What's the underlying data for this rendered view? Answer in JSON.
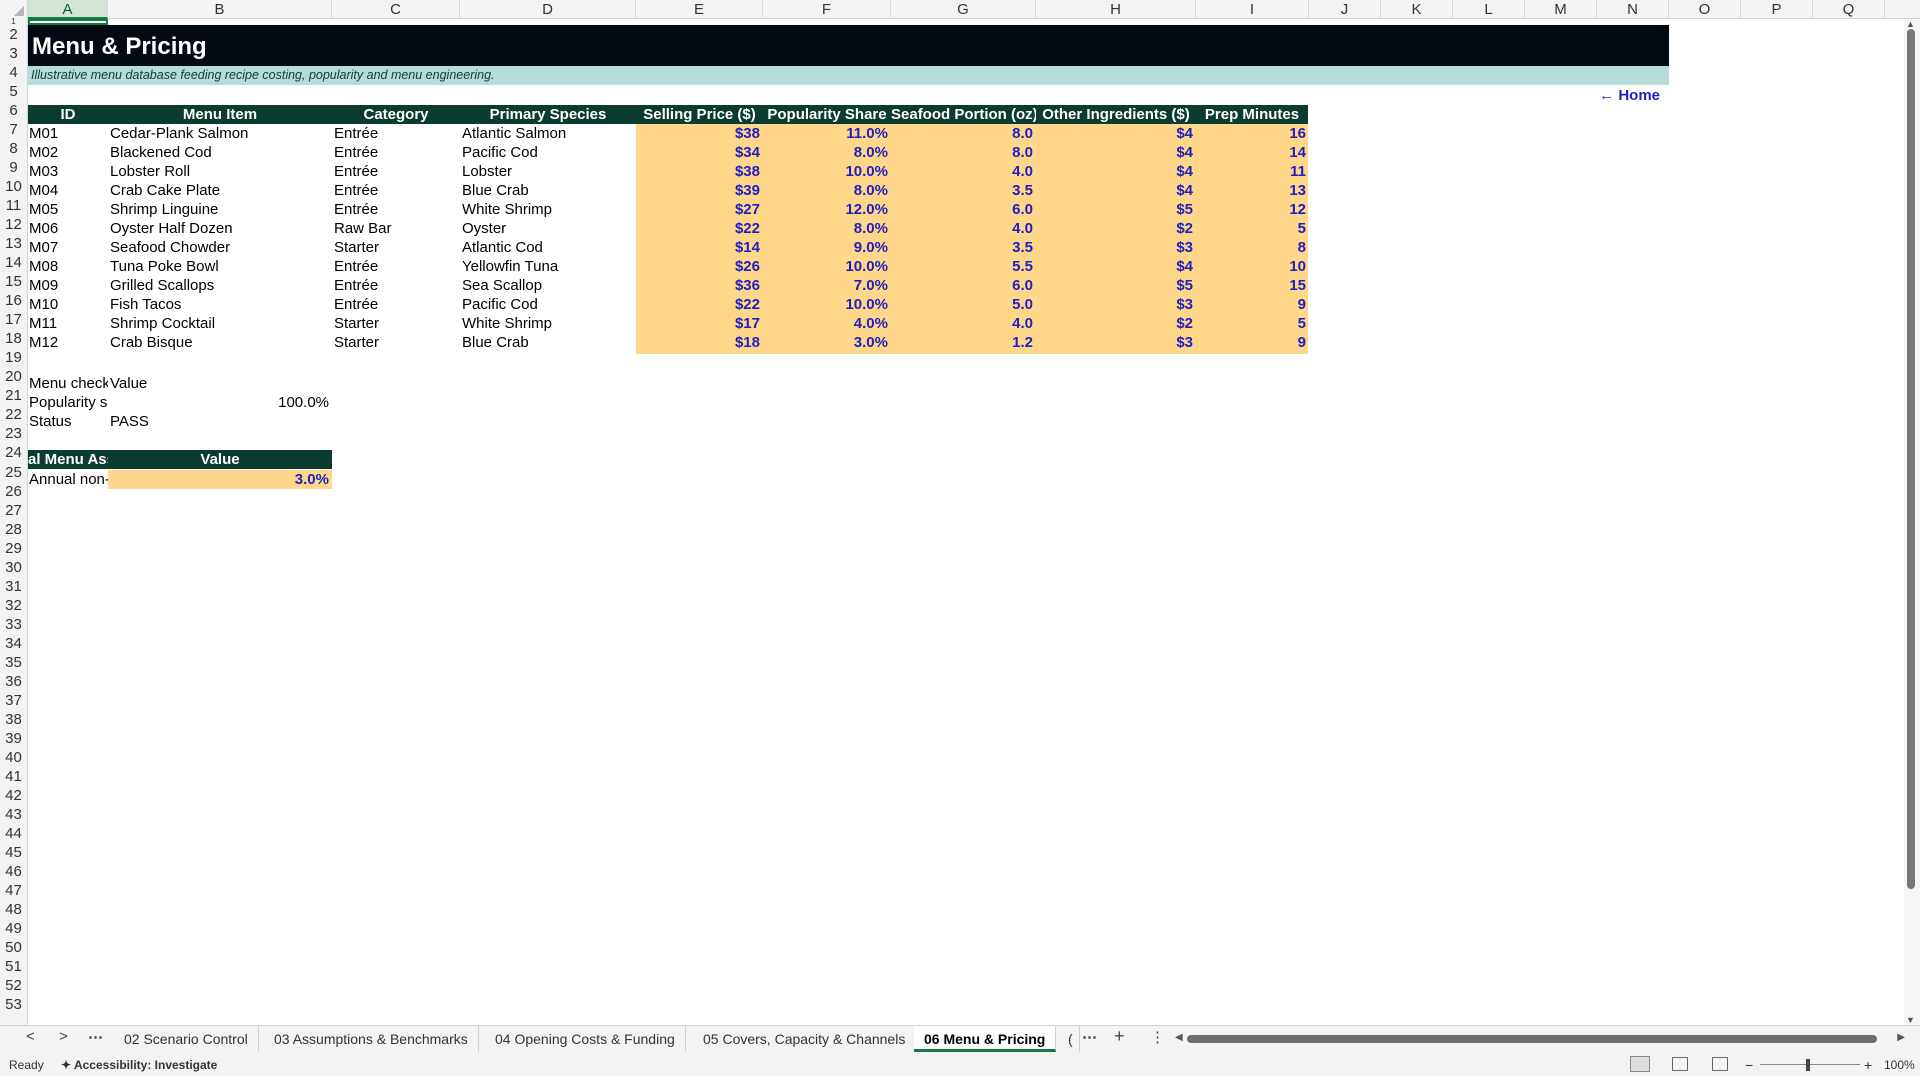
{
  "columns": [
    "A",
    "B",
    "C",
    "D",
    "E",
    "F",
    "G",
    "H",
    "I",
    "J",
    "K",
    "L",
    "M",
    "N",
    "O",
    "P",
    "Q"
  ],
  "row_numbers": [
    "1",
    "2",
    "3",
    "4",
    "5",
    "6",
    "7",
    "8",
    "9",
    "10",
    "11",
    "12",
    "13",
    "14",
    "15",
    "16",
    "17",
    "18",
    "19",
    "20",
    "21",
    "22",
    "23",
    "24",
    "25",
    "26",
    "27",
    "28",
    "29",
    "30",
    "31",
    "32",
    "33",
    "34",
    "35",
    "36",
    "37",
    "38",
    "39",
    "40",
    "41",
    "42",
    "43",
    "44",
    "45",
    "46",
    "47",
    "48",
    "49",
    "50",
    "51",
    "52",
    "53"
  ],
  "sheet": {
    "title": "Menu & Pricing",
    "subtitle": "Illustrative menu database feeding recipe costing, popularity and menu engineering.",
    "home_link": "← Home",
    "table_headers": [
      "ID",
      "Menu Item",
      "Category",
      "Primary Species",
      "Selling Price ($)",
      "Popularity Share",
      "Seafood Portion (oz)",
      "Other Ingredients ($)",
      "Prep Minutes"
    ],
    "rows": [
      [
        "M01",
        "Cedar-Plank Salmon",
        "Entrée",
        "Atlantic Salmon",
        "$38",
        "11.0%",
        "8.0",
        "$4",
        "16"
      ],
      [
        "M02",
        "Blackened Cod",
        "Entrée",
        "Pacific Cod",
        "$34",
        "8.0%",
        "8.0",
        "$4",
        "14"
      ],
      [
        "M03",
        "Lobster Roll",
        "Entrée",
        "Lobster",
        "$38",
        "10.0%",
        "4.0",
        "$4",
        "11"
      ],
      [
        "M04",
        "Crab Cake Plate",
        "Entrée",
        "Blue Crab",
        "$39",
        "8.0%",
        "3.5",
        "$4",
        "13"
      ],
      [
        "M05",
        "Shrimp Linguine",
        "Entrée",
        "White Shrimp",
        "$27",
        "12.0%",
        "6.0",
        "$5",
        "12"
      ],
      [
        "M06",
        "Oyster Half Dozen",
        "Raw Bar",
        "Oyster",
        "$22",
        "8.0%",
        "4.0",
        "$2",
        "5"
      ],
      [
        "M07",
        "Seafood Chowder",
        "Starter",
        "Atlantic Cod",
        "$14",
        "9.0%",
        "3.5",
        "$3",
        "8"
      ],
      [
        "M08",
        "Tuna Poke Bowl",
        "Entrée",
        "Yellowfin Tuna",
        "$26",
        "10.0%",
        "5.5",
        "$4",
        "10"
      ],
      [
        "M09",
        "Grilled Scallops",
        "Entrée",
        "Sea Scallop",
        "$36",
        "7.0%",
        "6.0",
        "$5",
        "15"
      ],
      [
        "M10",
        "Fish Tacos",
        "Entrée",
        "Pacific Cod",
        "$22",
        "10.0%",
        "5.0",
        "$3",
        "9"
      ],
      [
        "M11",
        "Shrimp Cocktail",
        "Starter",
        "White Shrimp",
        "$17",
        "4.0%",
        "4.0",
        "$2",
        "5"
      ],
      [
        "M12",
        "Crab Bisque",
        "Starter",
        "Blue Crab",
        "$18",
        "3.0%",
        "1.2",
        "$3",
        "9"
      ]
    ],
    "check": {
      "label_header": "Menu check",
      "value_header": "Value",
      "row1_label": "Popularity s",
      "row1_value": "100.0%",
      "row2_label": "Status",
      "row2_value": "PASS"
    },
    "assumption": {
      "header_label": "al Menu Ass",
      "header_value": "Value",
      "row_label": "Annual non-",
      "row_value": "3.0%"
    }
  },
  "tabs": {
    "prev": "<",
    "next": ">",
    "more_left": "⋯",
    "items": [
      "02 Scenario Control",
      "03 Assumptions & Benchmarks",
      "04 Opening Costs & Funding",
      "05 Covers, Capacity & Channels",
      "06 Menu & Pricing"
    ],
    "partial": "(",
    "more_right": "⋯",
    "add": "+",
    "options": "⋮"
  },
  "status": {
    "ready": "Ready",
    "accessibility": "Accessibility: Investigate",
    "zoom": "100%",
    "zoom_minus": "−",
    "zoom_plus": "+"
  },
  "colors": {
    "title_bar": "#030a12",
    "subtitle_bar": "#b5dcd9",
    "table_header": "#0c3b30",
    "input_fill": "#ffd78a",
    "input_text": "#1f1fbf"
  }
}
